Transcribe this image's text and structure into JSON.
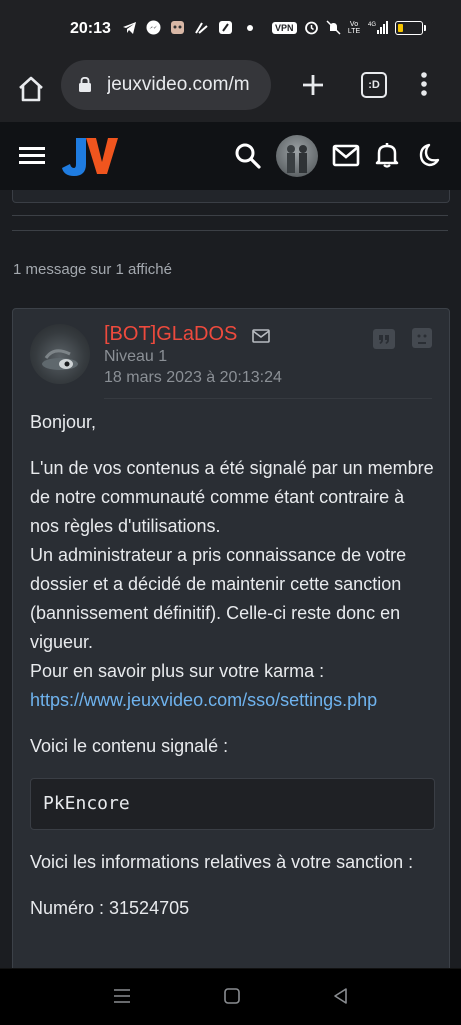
{
  "status_bar": {
    "time": "20:13",
    "vpn": "VPN",
    "volte": "Vo LTE",
    "network": "4G"
  },
  "browser": {
    "url": "jeuxvideo.com/m",
    "tabs_label": ":D"
  },
  "site": {
    "logo_alt": "JV",
    "accent": "#ee4a3d"
  },
  "topic": {
    "count_text": "1 message sur 1 affiché"
  },
  "message": {
    "author": "[BOT]GLaDOS",
    "level": "Niveau 1",
    "date": "18 mars 2023 à 20:13:24",
    "greeting": "Bonjour,",
    "para1": "L'un de vos contenus a été signalé par un membre de notre communauté comme étant contraire à nos règles d'utilisations.",
    "para2": "Un administrateur a pris connaissance de votre dossier et a décidé de maintenir cette sanction (bannissement définitif). Celle-ci reste donc en vigueur.",
    "para3": "Pour en savoir plus sur votre karma :",
    "link": "https://www.jeuxvideo.com/sso/settings.php",
    "reported_intro": "Voici le contenu signalé :",
    "reported_content": "PkEncore",
    "sanction_intro": "Voici les informations relatives à votre sanction :",
    "number_line": "Numéro : 31524705"
  }
}
